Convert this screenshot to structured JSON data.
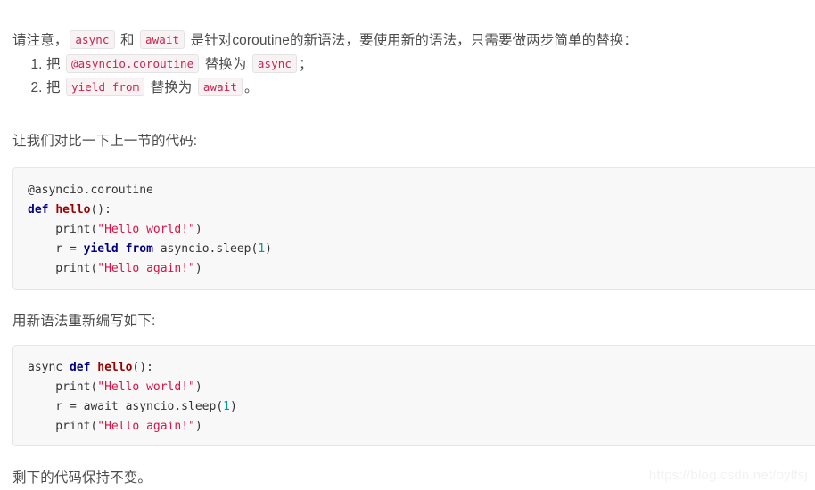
{
  "article": {
    "intro": {
      "before": "请注意，",
      "code1": "async",
      "middle": " 和 ",
      "code2": "await",
      "after": " 是针对coroutine的新语法，要使用新的语法，只需要做两步简单的替换："
    },
    "steps": [
      {
        "prefix": "把 ",
        "from_code": "@asyncio.coroutine",
        "middle": " 替换为 ",
        "to_code": "async",
        "suffix": "；"
      },
      {
        "prefix": "把 ",
        "from_code": "yield from",
        "middle": " 替换为 ",
        "to_code": "await",
        "suffix": "。"
      }
    ],
    "compare_caption": "让我们对比一下上一节的代码:",
    "rewrite_caption": "用新语法重新编写如下:",
    "closing": "剩下的代码保持不变。"
  },
  "code_blocks": [
    {
      "language": "python",
      "plain_text": "@asyncio.coroutine\ndef hello():\n    print(\"Hello world!\")\n    r = yield from asyncio.sleep(1)\n    print(\"Hello again!\")",
      "lines": [
        [
          {
            "t": "@asyncio.coroutine",
            "c": "dec"
          }
        ],
        [
          {
            "t": "def",
            "c": "kw"
          },
          {
            "t": " ",
            "c": "plain"
          },
          {
            "t": "hello",
            "c": "fn"
          },
          {
            "t": "():",
            "c": "punc"
          }
        ],
        [
          {
            "t": "    print(",
            "c": "plain"
          },
          {
            "t": "\"Hello world!\"",
            "c": "str"
          },
          {
            "t": ")",
            "c": "plain"
          }
        ],
        [
          {
            "t": "    r = ",
            "c": "plain"
          },
          {
            "t": "yield from",
            "c": "kw"
          },
          {
            "t": " asyncio.sleep(",
            "c": "plain"
          },
          {
            "t": "1",
            "c": "num"
          },
          {
            "t": ")",
            "c": "plain"
          }
        ],
        [
          {
            "t": "    print(",
            "c": "plain"
          },
          {
            "t": "\"Hello again!\"",
            "c": "str"
          },
          {
            "t": ")",
            "c": "plain"
          }
        ]
      ]
    },
    {
      "language": "python",
      "plain_text": "async def hello():\n    print(\"Hello world!\")\n    r = await asyncio.sleep(1)\n    print(\"Hello again!\")",
      "lines": [
        [
          {
            "t": "async ",
            "c": "plain"
          },
          {
            "t": "def",
            "c": "kw"
          },
          {
            "t": " ",
            "c": "plain"
          },
          {
            "t": "hello",
            "c": "fn"
          },
          {
            "t": "():",
            "c": "punc"
          }
        ],
        [
          {
            "t": "    print(",
            "c": "plain"
          },
          {
            "t": "\"Hello world!\"",
            "c": "str"
          },
          {
            "t": ")",
            "c": "plain"
          }
        ],
        [
          {
            "t": "    r = await asyncio.sleep(",
            "c": "plain"
          },
          {
            "t": "1",
            "c": "num"
          },
          {
            "t": ")",
            "c": "plain"
          }
        ],
        [
          {
            "t": "    print(",
            "c": "plain"
          },
          {
            "t": "\"Hello again!\"",
            "c": "str"
          },
          {
            "t": ")",
            "c": "plain"
          }
        ]
      ]
    }
  ],
  "watermark": {
    "text": "https://blog.csdn.net/bylfsj"
  },
  "colors": {
    "body_text": "#4c4c4c",
    "inline_code_text": "#c7254e",
    "inline_code_bg": "#f9f2f4",
    "code_block_bg": "#f8f8f8",
    "code_block_border": "#e6e6e6",
    "keyword": "#000080",
    "function_name": "#990000",
    "string": "#dd1144",
    "number": "#009999",
    "watermark": "#f2f2f2"
  }
}
